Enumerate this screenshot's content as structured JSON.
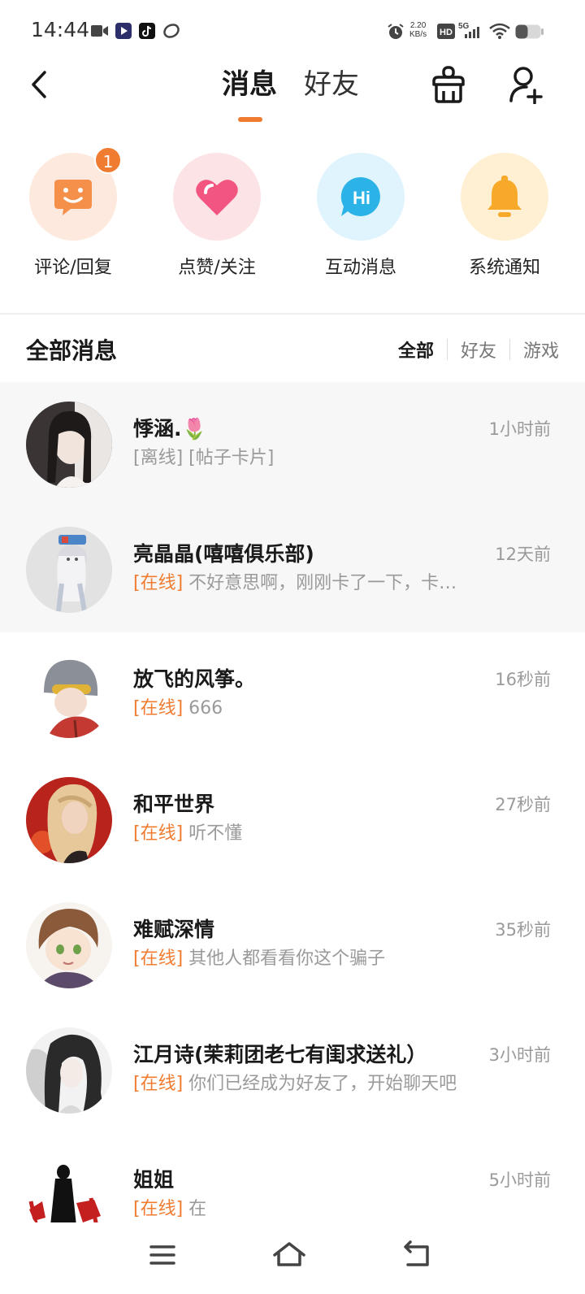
{
  "status_bar": {
    "time": "14:44",
    "net_speed_value": "2.20",
    "net_speed_unit": "KB/s",
    "hd_label": "HD",
    "net_type": "5G"
  },
  "nav": {
    "tabs": [
      {
        "label": "消息",
        "active": true
      },
      {
        "label": "好友",
        "active": false
      }
    ],
    "icons": [
      "back-icon",
      "clean-basket-icon",
      "add-friend-icon"
    ]
  },
  "quick_actions": [
    {
      "label": "评论/回复",
      "icon": "comment-icon",
      "badge": "1",
      "bg": "#fde9de",
      "color": "#f5904a"
    },
    {
      "label": "点赞/关注",
      "icon": "heart-icon",
      "badge": "",
      "bg": "#fce4e6",
      "color": "#f25580"
    },
    {
      "label": "互动消息",
      "icon": "hi-bubble-icon",
      "badge": "",
      "bg": "#dff4fc",
      "color": "#2bb2e6"
    },
    {
      "label": "系统通知",
      "icon": "bell-icon",
      "badge": "",
      "bg": "#fff0d4",
      "color": "#f7a92a"
    }
  ],
  "section": {
    "title": "全部消息",
    "filters": [
      {
        "label": "全部",
        "active": true
      },
      {
        "label": "好友",
        "active": false
      },
      {
        "label": "游戏",
        "active": false
      }
    ]
  },
  "messages": [
    {
      "name": "悸涵.🌷",
      "status": "[离线]",
      "online": false,
      "preview": " [帖子卡片]",
      "time": "1小时前",
      "pinned": true
    },
    {
      "name": "亮晶晶(嘻嘻俱乐部)",
      "status": "[在线]",
      "online": true,
      "preview": " 不好意思啊，刚刚卡了一下，卡…",
      "time": "12天前",
      "pinned": true
    },
    {
      "name": "放飞的风筝。",
      "status": "[在线]",
      "online": true,
      "preview": " 666",
      "time": "16秒前",
      "pinned": false
    },
    {
      "name": "和平世界",
      "status": "[在线]",
      "online": true,
      "preview": " 听不懂",
      "time": "27秒前",
      "pinned": false
    },
    {
      "name": "难赋深情",
      "status": "[在线]",
      "online": true,
      "preview": " 其他人都看看你这个骗子",
      "time": "35秒前",
      "pinned": false
    },
    {
      "name": "江月诗(茉莉团老七有闺求送礼）",
      "status": "[在线]",
      "online": true,
      "preview": " 你们已经成为好友了，开始聊天吧",
      "time": "3小时前",
      "pinned": false
    },
    {
      "name": "姐姐",
      "status": "[在线]",
      "online": true,
      "preview": " 在",
      "time": "5小时前",
      "pinned": false
    }
  ],
  "system_nav": [
    "menu-icon",
    "home-icon",
    "back-nav-icon"
  ]
}
